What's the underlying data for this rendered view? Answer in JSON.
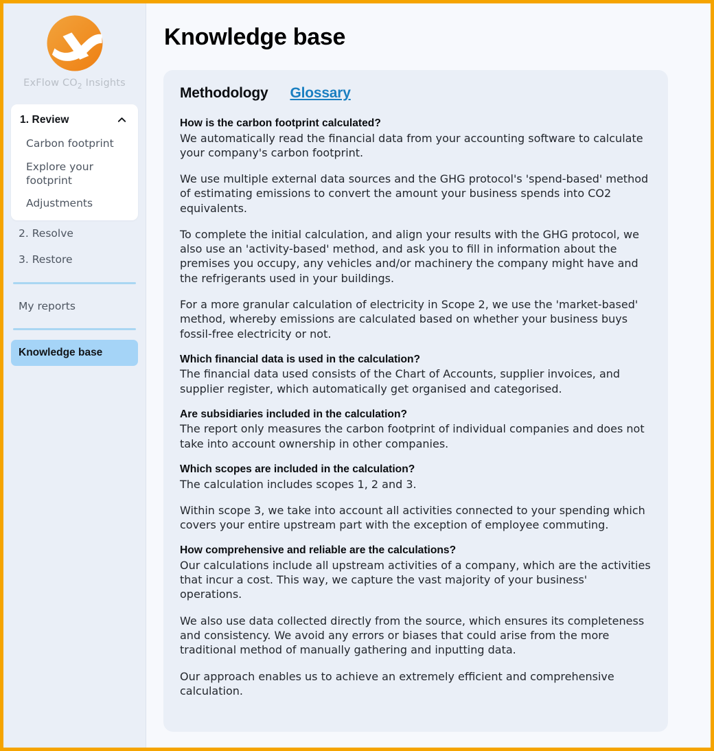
{
  "brand": {
    "name_before": "ExFlow CO",
    "name_sub": "2",
    "name_after": " Insights",
    "logo_icon": "exflow-x-logo-icon",
    "accent_color": "#f5a400"
  },
  "sidebar": {
    "group": {
      "label": "1. Review",
      "chevron_icon": "chevron-up-icon",
      "items": [
        {
          "label": "Carbon footprint"
        },
        {
          "label": "Explore your footprint"
        },
        {
          "label": "Adjustments"
        }
      ]
    },
    "steps": [
      {
        "label": "2. Resolve"
      },
      {
        "label": "3. Restore"
      }
    ],
    "reports": {
      "label": "My reports"
    },
    "knowledge": {
      "label": "Knowledge base",
      "active_color": "#a5d4f7"
    }
  },
  "header": {
    "title": "Knowledge base"
  },
  "main": {
    "tabs": [
      {
        "label": "Methodology",
        "active": true
      },
      {
        "label": "Glossary",
        "active": false
      }
    ],
    "blocks": [
      {
        "type": "heading",
        "text": "How is the carbon footprint calculated?"
      },
      {
        "type": "paragraph",
        "text": "We automatically read the financial data from your accounting software to calculate your company's carbon footprint."
      },
      {
        "type": "gap"
      },
      {
        "type": "paragraph",
        "text": "We use multiple external data sources and the GHG protocol's 'spend-based' method of estimating emissions to convert the amount your business spends into CO2 equivalents."
      },
      {
        "type": "gap"
      },
      {
        "type": "paragraph",
        "text": "To complete the initial calculation, and align your results with the GHG protocol, we also use an 'activity-based' method, and ask you to fill in information about the premises you occupy, any vehicles and/or machinery the company might have and the refrigerants used in your buildings."
      },
      {
        "type": "gap"
      },
      {
        "type": "paragraph",
        "text": "For a more granular calculation of electricity in Scope 2, we use the 'market-based' method, whereby emissions are calculated based on whether your business buys fossil-free electricity or not."
      },
      {
        "type": "gap"
      },
      {
        "type": "heading",
        "text": "Which financial data is used in the calculation?"
      },
      {
        "type": "paragraph",
        "text": "The financial data used consists of the Chart of Accounts, supplier invoices, and supplier register, which automatically get organised and categorised."
      },
      {
        "type": "gap"
      },
      {
        "type": "heading",
        "text": "Are subsidiaries included in the calculation?"
      },
      {
        "type": "paragraph",
        "text": "The report only measures the carbon footprint of individual companies and does not take into account ownership in other companies."
      },
      {
        "type": "gap"
      },
      {
        "type": "heading",
        "text": "Which scopes are included in the calculation?"
      },
      {
        "type": "paragraph",
        "text": "The calculation includes scopes 1, 2 and 3."
      },
      {
        "type": "gap"
      },
      {
        "type": "paragraph",
        "text": "Within scope 3, we take into account all activities connected to your spending which covers your entire upstream part with the exception of employee commuting."
      },
      {
        "type": "gap"
      },
      {
        "type": "heading",
        "text": "How comprehensive and reliable are the calculations?"
      },
      {
        "type": "paragraph",
        "text": "Our calculations include all upstream activities of a company, which are the activities that incur a cost. This way, we capture the vast majority of your business' operations."
      },
      {
        "type": "gap"
      },
      {
        "type": "paragraph",
        "text": "We also use data collected directly from the source, which ensures its completeness and consistency. We avoid any errors or biases that could arise from the more traditional method of manually gathering and inputting data."
      },
      {
        "type": "gap"
      },
      {
        "type": "paragraph",
        "text": "Our approach enables us to achieve an extremely efficient and comprehensive calculation."
      }
    ]
  }
}
